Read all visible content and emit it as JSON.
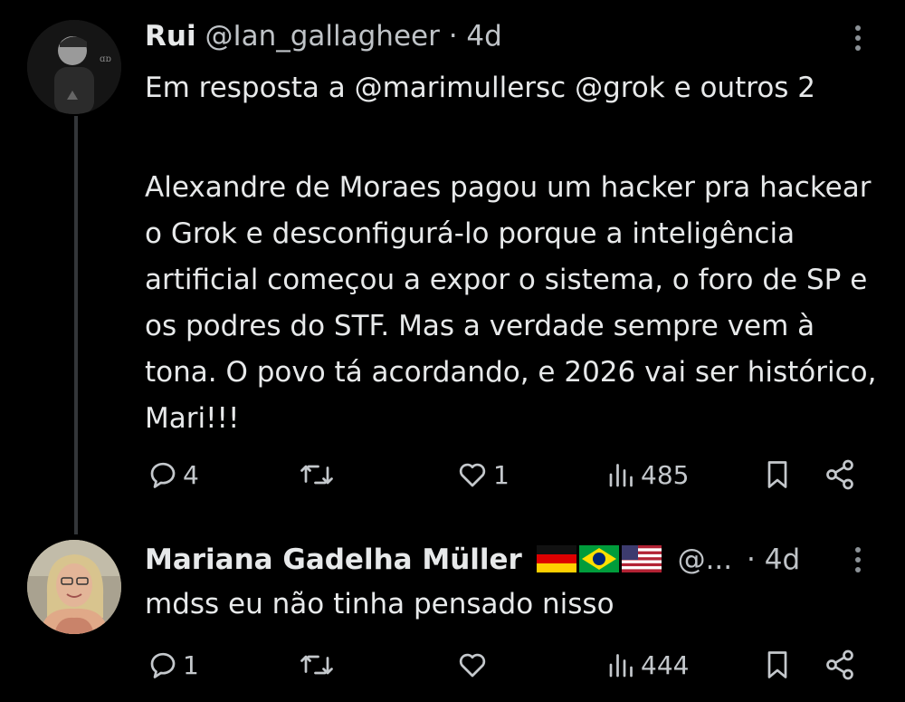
{
  "tweets": [
    {
      "name": "Rui",
      "handle": "@Ian_gallagheer",
      "separator": "·",
      "time": "4d",
      "reply_to": "Em resposta a @marimullersc @grok e outros 2",
      "text": "Alexandre de Moraes pagou um hacker pra hackear o Grok e desconfigurá-lo porque a inteligência artificial começou a expor o sistema, o foro de SP e os podres do STF. Mas a verdade sempre vem à tona. O povo tá acordando, e 2026 vai ser histórico, Mari!!!",
      "stats": {
        "replies": "4",
        "reposts": "",
        "likes": "1",
        "views": "485"
      }
    },
    {
      "name": "Mariana Gadelha Müller",
      "flags": [
        "germany-flag",
        "brazil-flag",
        "usa-flag"
      ],
      "handle": "@...",
      "separator": "·",
      "time": "4d",
      "text": "mdss eu não tinha pensado nisso",
      "stats": {
        "replies": "1",
        "reposts": "",
        "likes": "",
        "views": "444"
      }
    }
  ],
  "colors": {
    "background": "#000000",
    "text": "#e7e9ea",
    "muted": "#bfc3c7",
    "icon": "#c4c8cc",
    "thread_line": "#333639"
  }
}
